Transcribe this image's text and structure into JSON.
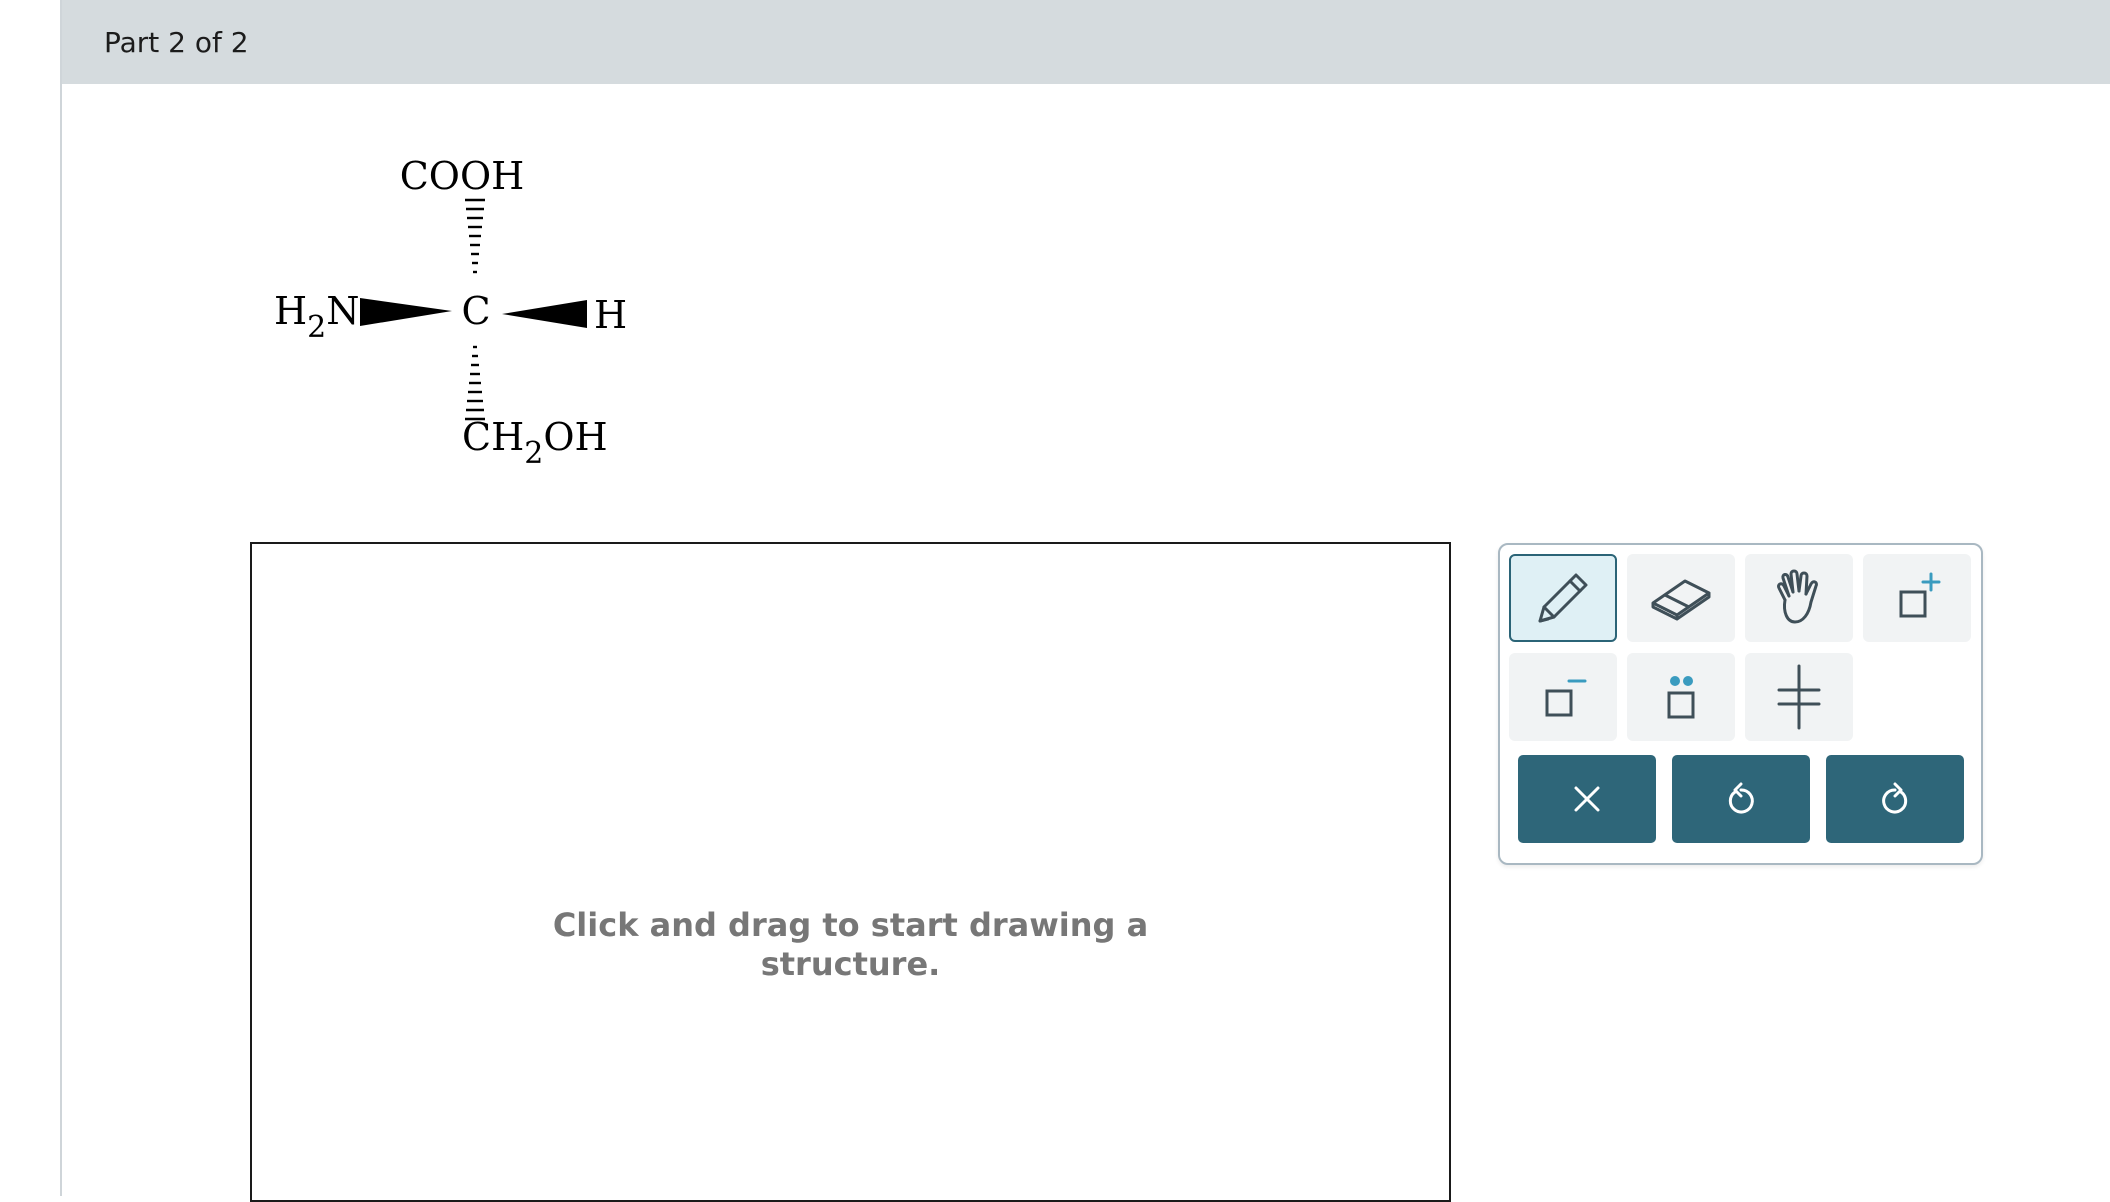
{
  "header": {
    "part_label": "Part 2 of 2"
  },
  "molecule": {
    "top_group": "COOH",
    "center_atom": "C",
    "left_group_H": "H",
    "left_group_sub": "2",
    "left_group_N": "N",
    "right_group": "H",
    "bottom_group_CH": "CH",
    "bottom_group_sub": "2",
    "bottom_group_OH": "OH"
  },
  "canvas": {
    "hint_line1": "Click and drag to start drawing a",
    "hint_line2": "structure."
  },
  "toolbox": {
    "tools": [
      {
        "name": "pencil-tool",
        "icon": "pencil-icon",
        "selected": true
      },
      {
        "name": "eraser-tool",
        "icon": "eraser-icon",
        "selected": false
      },
      {
        "name": "hand-tool",
        "icon": "hand-icon",
        "selected": false
      },
      {
        "name": "positive-charge-tool",
        "icon": "positive-charge-icon",
        "selected": false
      },
      {
        "name": "negative-charge-tool",
        "icon": "negative-charge-icon",
        "selected": false
      },
      {
        "name": "lone-pair-tool",
        "icon": "lone-pair-icon",
        "selected": false
      },
      {
        "name": "template-tool",
        "icon": "hash-icon",
        "selected": false
      }
    ],
    "actions": [
      {
        "name": "clear-button",
        "icon": "close-icon"
      },
      {
        "name": "undo-button",
        "icon": "undo-icon"
      },
      {
        "name": "redo-button",
        "icon": "redo-icon"
      }
    ]
  },
  "colors": {
    "header_bg": "#d5dbde",
    "accent": "#2e6679",
    "charge_accent": "#3a9bbf",
    "hint_text": "#777777"
  }
}
